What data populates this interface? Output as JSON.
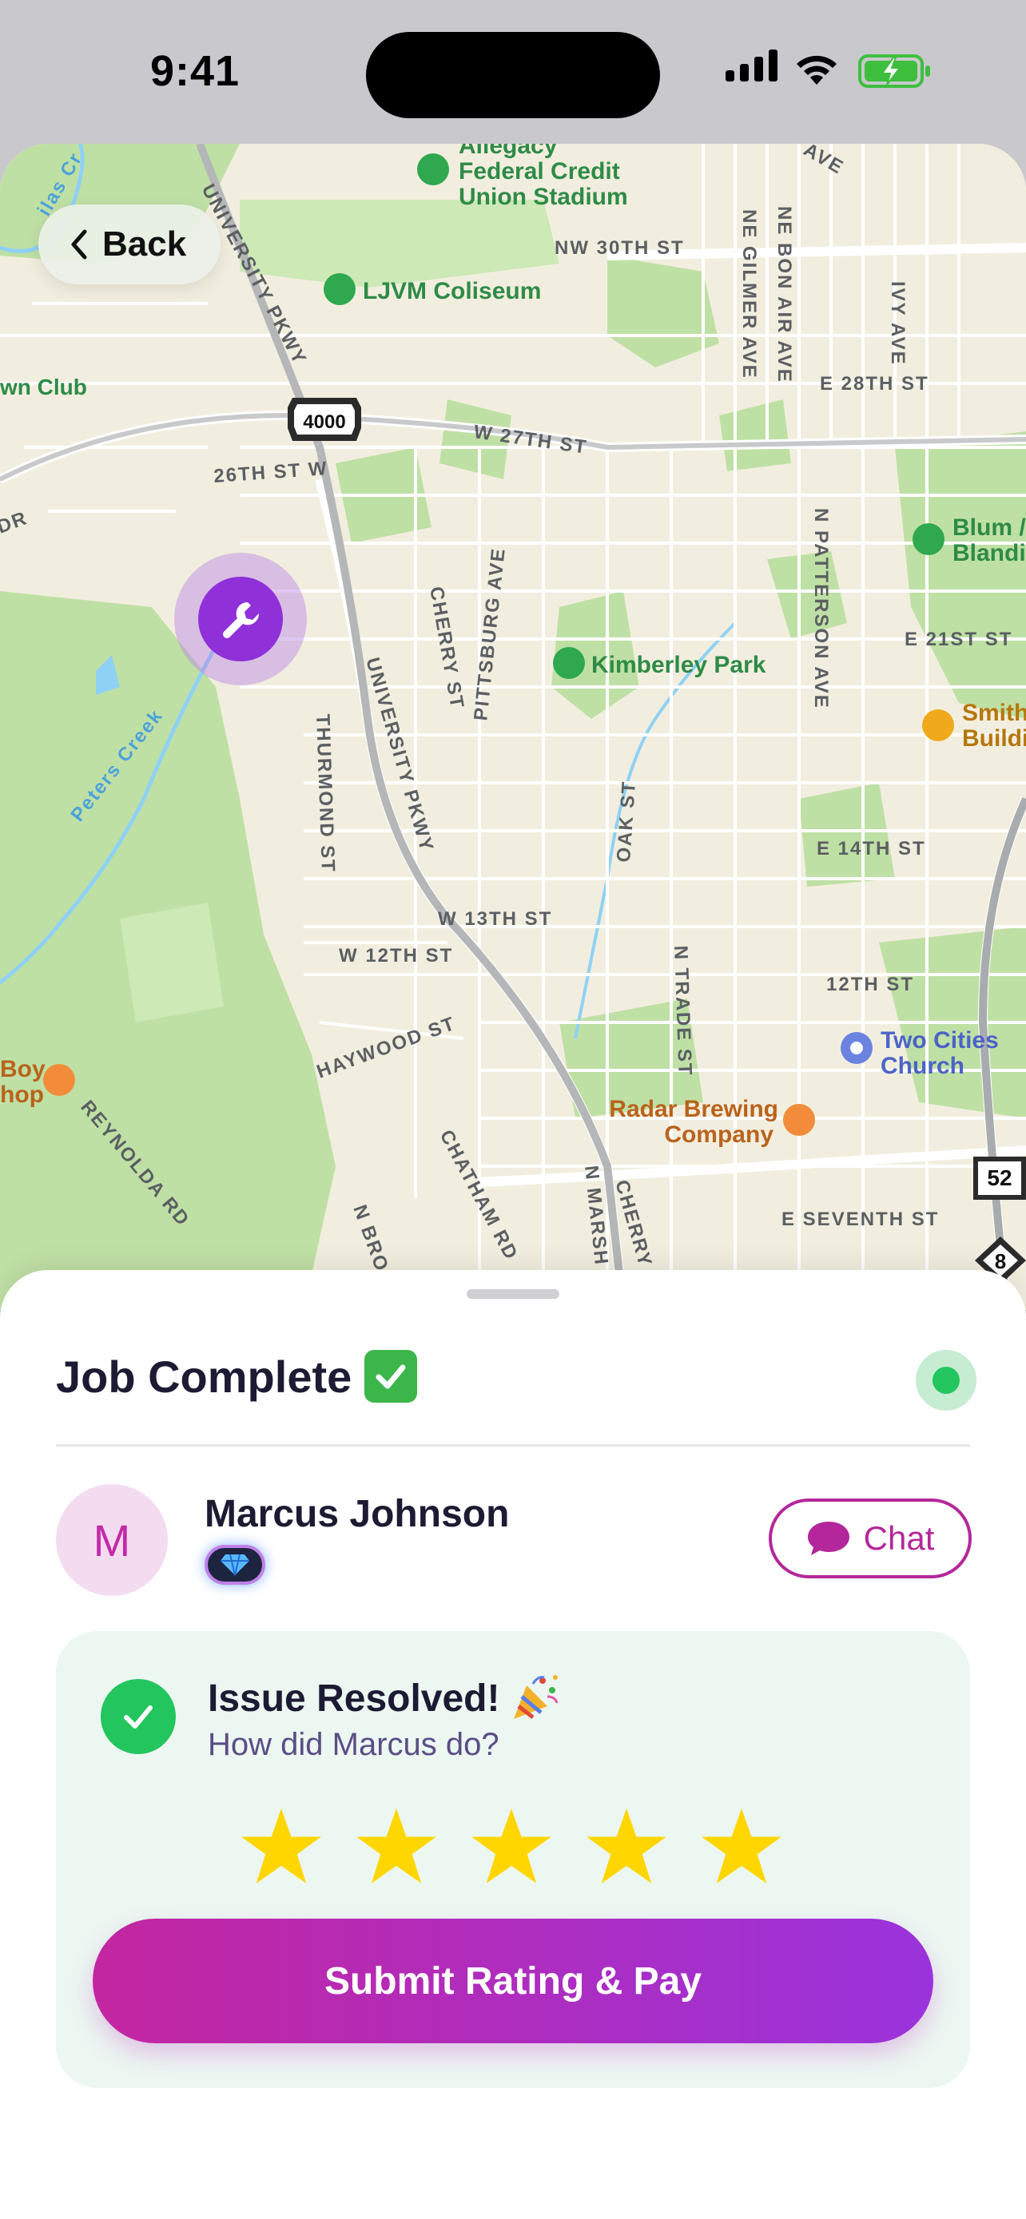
{
  "status_bar": {
    "time": "9:41"
  },
  "nav": {
    "back_label": "Back"
  },
  "map": {
    "places": {
      "stadium": [
        "Allegacy",
        "Federal Credit",
        "Union Stadium"
      ],
      "coliseum": "LJVM Coliseum",
      "park": "Kimberley Park",
      "lawn_club": "wn Club",
      "blum": [
        "Blum /",
        "Blandi"
      ],
      "smith": [
        "Smith",
        "Buildi"
      ],
      "church": [
        "Two Cities",
        "Church"
      ],
      "brewing": [
        "Radar Brewing",
        "Company"
      ],
      "boy_shop": [
        "Boy",
        "hop"
      ]
    },
    "streets": {
      "nw30": "NW 30TH ST",
      "e28": "E 28TH ST",
      "w27": "W 27TH ST",
      "s26": "26TH ST W",
      "e21": "E 21ST ST",
      "e14": "E 14TH ST",
      "w13": "W 13TH ST",
      "w12": "W 12TH ST",
      "s12": "12TH ST",
      "seventh": "E SEVENTH ST",
      "univ1": "UNIVERSITY PKWY",
      "univ2": "UNIVERSITY PKWY",
      "cherry": "CHERRY ST",
      "cherry2": "CHERRY",
      "pittsburg": "PITTSBURG AVE",
      "thurmond": "THURMOND ST",
      "oak": "OAK ST",
      "trade": "N TRADE ST",
      "patterson": "N PATTERSON AVE",
      "gilmer": "NE GILMER AVE",
      "bonair": "NE BON AIR AVE",
      "ivy": "IVY AVE",
      "ave": "AVE",
      "haywood": "HAYWOOD ST",
      "chatham": "CHATHAM RD",
      "reynolda": "REYNOLDA RD",
      "nbro": "N BRO",
      "nmarsh": "N MARSH",
      "dr": "DR",
      "creek": "Peters Creek",
      "silas": "ilas Cr"
    },
    "shields": {
      "hwy4000": "4000",
      "i52": "52",
      "i8": "8"
    }
  },
  "sheet": {
    "title": "Job Complete",
    "technician": {
      "initial": "M",
      "name": "Marcus Johnson"
    },
    "chat_label": "Chat",
    "card": {
      "title": "Issue Resolved!",
      "subtitle": "How did Marcus do?",
      "rating": 5,
      "rating_max": 5,
      "submit_label": "Submit Rating & Pay"
    }
  },
  "colors": {
    "accent": "#b4279a",
    "gradient_start": "#c326a0",
    "gradient_end": "#9a33dc",
    "success": "#22c55e",
    "star": "#ffd600"
  }
}
